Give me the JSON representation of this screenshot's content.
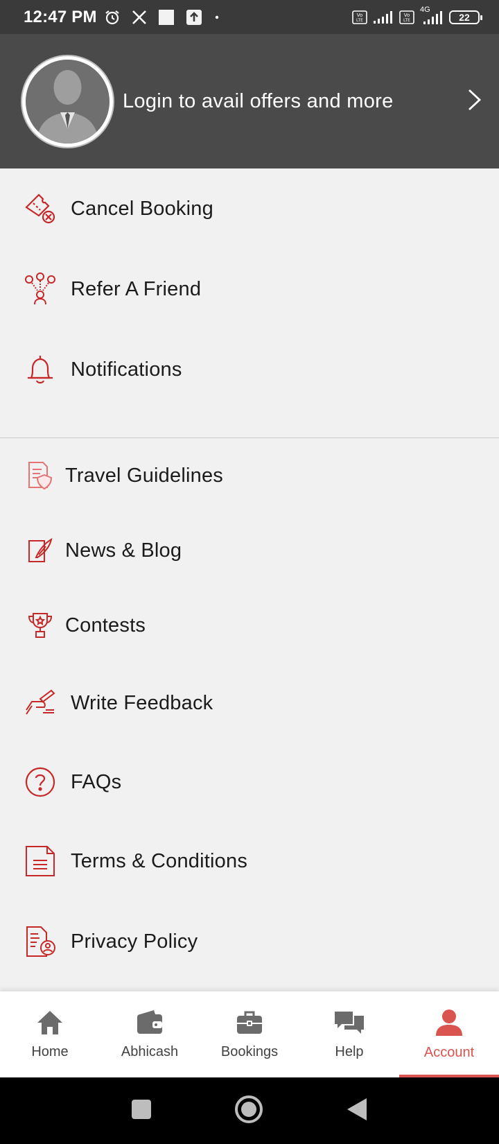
{
  "status_bar": {
    "time": "12:47 PM",
    "battery": "22",
    "network": "4G",
    "icons": [
      "alarm-icon",
      "x-logo-icon",
      "square-icon",
      "upload-icon",
      "dot-icon",
      "volte-icon",
      "signal-icon",
      "volte-icon",
      "signal-icon",
      "battery-icon"
    ]
  },
  "header": {
    "login_text": "Login to avail offers and more"
  },
  "menu": {
    "group1": [
      {
        "label": "Cancel Booking",
        "icon": "cancel-ticket-icon"
      },
      {
        "label": "Refer A Friend",
        "icon": "refer-friend-icon"
      },
      {
        "label": "Notifications",
        "icon": "bell-icon"
      }
    ],
    "group2": [
      {
        "label": "Travel Guidelines",
        "icon": "guidelines-shield-icon"
      },
      {
        "label": "News & Blog",
        "icon": "news-blog-icon"
      },
      {
        "label": "Contests",
        "icon": "trophy-icon"
      },
      {
        "label": "Write Feedback",
        "icon": "feedback-pen-icon"
      },
      {
        "label": "FAQs",
        "icon": "question-icon"
      },
      {
        "label": "Terms & Conditions",
        "icon": "document-icon"
      },
      {
        "label": "Privacy Policy",
        "icon": "privacy-document-icon"
      }
    ]
  },
  "bottom_nav": {
    "items": [
      {
        "label": "Home",
        "icon": "home-icon"
      },
      {
        "label": "Abhicash",
        "icon": "wallet-icon"
      },
      {
        "label": "Bookings",
        "icon": "briefcase-icon"
      },
      {
        "label": "Help",
        "icon": "chat-bubbles-icon"
      },
      {
        "label": "Account",
        "icon": "user-icon"
      }
    ],
    "active": "Account"
  },
  "colors": {
    "accent": "#d9534f",
    "icon_red": "#c62828",
    "header_bg": "#4a4a4a",
    "status_bg": "#3a3a3a",
    "page_bg": "#f1f1f1"
  }
}
